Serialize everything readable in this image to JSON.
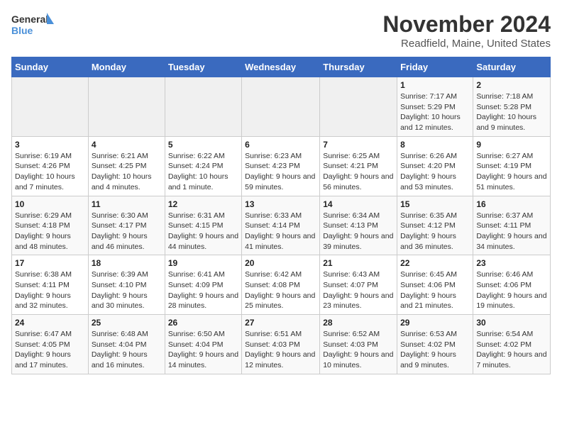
{
  "logo": {
    "general": "General",
    "blue": "Blue"
  },
  "title": "November 2024",
  "location": "Readfield, Maine, United States",
  "days_of_week": [
    "Sunday",
    "Monday",
    "Tuesday",
    "Wednesday",
    "Thursday",
    "Friday",
    "Saturday"
  ],
  "weeks": [
    [
      {
        "day": "",
        "info": ""
      },
      {
        "day": "",
        "info": ""
      },
      {
        "day": "",
        "info": ""
      },
      {
        "day": "",
        "info": ""
      },
      {
        "day": "",
        "info": ""
      },
      {
        "day": "1",
        "info": "Sunrise: 7:17 AM\nSunset: 5:29 PM\nDaylight: 10 hours and 12 minutes."
      },
      {
        "day": "2",
        "info": "Sunrise: 7:18 AM\nSunset: 5:28 PM\nDaylight: 10 hours and 9 minutes."
      }
    ],
    [
      {
        "day": "3",
        "info": "Sunrise: 6:19 AM\nSunset: 4:26 PM\nDaylight: 10 hours and 7 minutes."
      },
      {
        "day": "4",
        "info": "Sunrise: 6:21 AM\nSunset: 4:25 PM\nDaylight: 10 hours and 4 minutes."
      },
      {
        "day": "5",
        "info": "Sunrise: 6:22 AM\nSunset: 4:24 PM\nDaylight: 10 hours and 1 minute."
      },
      {
        "day": "6",
        "info": "Sunrise: 6:23 AM\nSunset: 4:23 PM\nDaylight: 9 hours and 59 minutes."
      },
      {
        "day": "7",
        "info": "Sunrise: 6:25 AM\nSunset: 4:21 PM\nDaylight: 9 hours and 56 minutes."
      },
      {
        "day": "8",
        "info": "Sunrise: 6:26 AM\nSunset: 4:20 PM\nDaylight: 9 hours and 53 minutes."
      },
      {
        "day": "9",
        "info": "Sunrise: 6:27 AM\nSunset: 4:19 PM\nDaylight: 9 hours and 51 minutes."
      }
    ],
    [
      {
        "day": "10",
        "info": "Sunrise: 6:29 AM\nSunset: 4:18 PM\nDaylight: 9 hours and 48 minutes."
      },
      {
        "day": "11",
        "info": "Sunrise: 6:30 AM\nSunset: 4:17 PM\nDaylight: 9 hours and 46 minutes."
      },
      {
        "day": "12",
        "info": "Sunrise: 6:31 AM\nSunset: 4:15 PM\nDaylight: 9 hours and 44 minutes."
      },
      {
        "day": "13",
        "info": "Sunrise: 6:33 AM\nSunset: 4:14 PM\nDaylight: 9 hours and 41 minutes."
      },
      {
        "day": "14",
        "info": "Sunrise: 6:34 AM\nSunset: 4:13 PM\nDaylight: 9 hours and 39 minutes."
      },
      {
        "day": "15",
        "info": "Sunrise: 6:35 AM\nSunset: 4:12 PM\nDaylight: 9 hours and 36 minutes."
      },
      {
        "day": "16",
        "info": "Sunrise: 6:37 AM\nSunset: 4:11 PM\nDaylight: 9 hours and 34 minutes."
      }
    ],
    [
      {
        "day": "17",
        "info": "Sunrise: 6:38 AM\nSunset: 4:11 PM\nDaylight: 9 hours and 32 minutes."
      },
      {
        "day": "18",
        "info": "Sunrise: 6:39 AM\nSunset: 4:10 PM\nDaylight: 9 hours and 30 minutes."
      },
      {
        "day": "19",
        "info": "Sunrise: 6:41 AM\nSunset: 4:09 PM\nDaylight: 9 hours and 28 minutes."
      },
      {
        "day": "20",
        "info": "Sunrise: 6:42 AM\nSunset: 4:08 PM\nDaylight: 9 hours and 25 minutes."
      },
      {
        "day": "21",
        "info": "Sunrise: 6:43 AM\nSunset: 4:07 PM\nDaylight: 9 hours and 23 minutes."
      },
      {
        "day": "22",
        "info": "Sunrise: 6:45 AM\nSunset: 4:06 PM\nDaylight: 9 hours and 21 minutes."
      },
      {
        "day": "23",
        "info": "Sunrise: 6:46 AM\nSunset: 4:06 PM\nDaylight: 9 hours and 19 minutes."
      }
    ],
    [
      {
        "day": "24",
        "info": "Sunrise: 6:47 AM\nSunset: 4:05 PM\nDaylight: 9 hours and 17 minutes."
      },
      {
        "day": "25",
        "info": "Sunrise: 6:48 AM\nSunset: 4:04 PM\nDaylight: 9 hours and 16 minutes."
      },
      {
        "day": "26",
        "info": "Sunrise: 6:50 AM\nSunset: 4:04 PM\nDaylight: 9 hours and 14 minutes."
      },
      {
        "day": "27",
        "info": "Sunrise: 6:51 AM\nSunset: 4:03 PM\nDaylight: 9 hours and 12 minutes."
      },
      {
        "day": "28",
        "info": "Sunrise: 6:52 AM\nSunset: 4:03 PM\nDaylight: 9 hours and 10 minutes."
      },
      {
        "day": "29",
        "info": "Sunrise: 6:53 AM\nSunset: 4:02 PM\nDaylight: 9 hours and 9 minutes."
      },
      {
        "day": "30",
        "info": "Sunrise: 6:54 AM\nSunset: 4:02 PM\nDaylight: 9 hours and 7 minutes."
      }
    ]
  ]
}
